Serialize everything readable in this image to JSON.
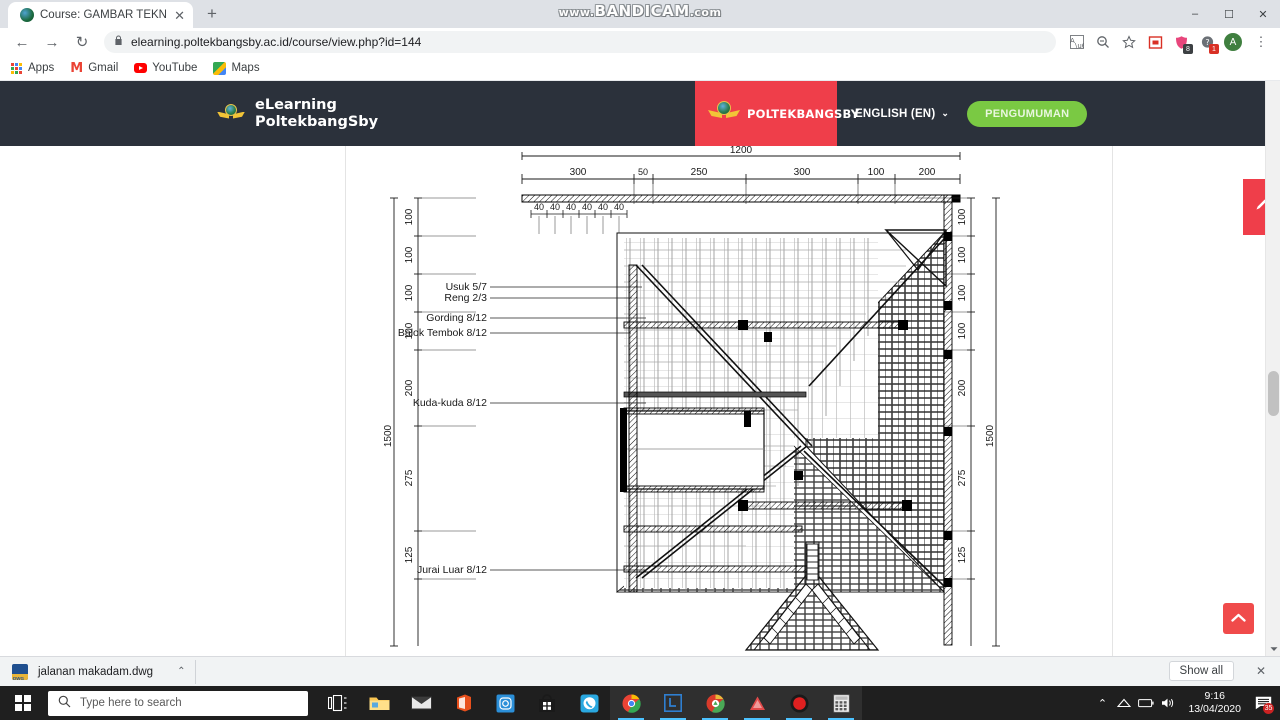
{
  "browser": {
    "tab": {
      "title": "Course: GAMBAR TEKNIK COMPU",
      "close": "✕",
      "favicon": "poltekbangsby-favicon"
    },
    "newtab_label": "+",
    "window_controls": {
      "minimize": "–",
      "maximize": "☐",
      "close": "✕"
    },
    "nav": {
      "back": "←",
      "forward": "→",
      "reload": "↻"
    },
    "omnibox": {
      "lock": "🔒",
      "url": "elearning.poltekbangsby.ac.id/course/view.php?id=144"
    },
    "toolbar_icons": [
      {
        "name": "translate-icon",
        "glyph": "文"
      },
      {
        "name": "zoom-out-icon",
        "glyph": "⌕"
      },
      {
        "name": "bookmark-star-icon",
        "glyph": "☆"
      },
      {
        "name": "extension-mailbox-icon",
        "glyph": "✉"
      },
      {
        "name": "extension-shield-icon",
        "glyph": "♥",
        "badge": "8",
        "badge_color": "#3c4043"
      },
      {
        "name": "extension-help-icon",
        "glyph": "?",
        "badge": "1",
        "badge_color": "#d93025"
      }
    ],
    "profile": {
      "initial": "A",
      "color": "#3f7f3f"
    },
    "menu": "⋮",
    "bookmarks": [
      {
        "label": "Apps",
        "icon": "apps-grid-icon"
      },
      {
        "label": "Gmail",
        "icon": "gmail-icon"
      },
      {
        "label": "YouTube",
        "icon": "youtube-icon"
      },
      {
        "label": "Maps",
        "icon": "maps-icon"
      }
    ]
  },
  "watermark": {
    "prefix": "www.",
    "main": "BANDICAM",
    "suffix": ".com"
  },
  "site": {
    "brand_line1": "eLearning",
    "brand_line2": "PoltekbangSby",
    "org_name": "POLTEKBANGSBY",
    "language": "ENGLISH (EN)",
    "language_chevron": "⌄",
    "announcement_button": "PENGUMUMAN",
    "header_bg": "#2b313b",
    "org_bg": "#ef3e4a",
    "announce_bg": "#7ac943"
  },
  "floating": {
    "edit_tab_icon": "pencil-icon",
    "edit_tab_color": "#ef3e4a",
    "scroll_top_icon": "chevron-up-icon",
    "scroll_top_color": "#f04b4b"
  },
  "drawing": {
    "title": "roof-framing-plan",
    "top_total": "1200",
    "top_segments": [
      "300",
      "50",
      "250",
      "300",
      "100",
      "200"
    ],
    "rafter_spacing": [
      "40",
      "40",
      "40",
      "40",
      "40",
      "40"
    ],
    "left_total": "1500",
    "left_segments": [
      "100",
      "100",
      "100",
      "100",
      "200",
      "275",
      "125"
    ],
    "right_total": "1500",
    "right_segments": [
      "100",
      "100",
      "100",
      "100",
      "200",
      "275",
      "125"
    ],
    "annotations": [
      "Usuk 5/7",
      "Reng 2/3",
      "Gording 8/12",
      "Balok Tembok 8/12",
      "Kuda-kuda 8/12",
      "Jurai Luar 8/12"
    ]
  },
  "downloads": {
    "file_name": "jalanan makadam.dwg",
    "caret": "⌃",
    "show_all": "Show all",
    "close": "✕"
  },
  "taskbar": {
    "search_placeholder": "Type here to search",
    "search_icon": "search-icon",
    "start_icon": "windows-start-icon",
    "apps": [
      {
        "name": "task-view-icon"
      },
      {
        "name": "file-explorer-icon"
      },
      {
        "name": "mail-icon"
      },
      {
        "name": "office-icon"
      },
      {
        "name": "instagram-icon"
      },
      {
        "name": "microsoft-store-icon"
      },
      {
        "name": "whatsapp-icon"
      },
      {
        "name": "chrome-icon",
        "active": true
      },
      {
        "name": "layout-sketchup-icon",
        "active": true
      },
      {
        "name": "chrome-canary-icon",
        "active": true
      },
      {
        "name": "autocad-icon",
        "active": true
      },
      {
        "name": "bandicam-icon",
        "active": true
      },
      {
        "name": "calculator-icon",
        "active": true
      }
    ],
    "tray": {
      "chevron": "⌃",
      "battery": "▮",
      "network": "◰",
      "volume": "🔊",
      "time": "9:16",
      "date": "13/04/2020",
      "notification_count": "35"
    }
  }
}
